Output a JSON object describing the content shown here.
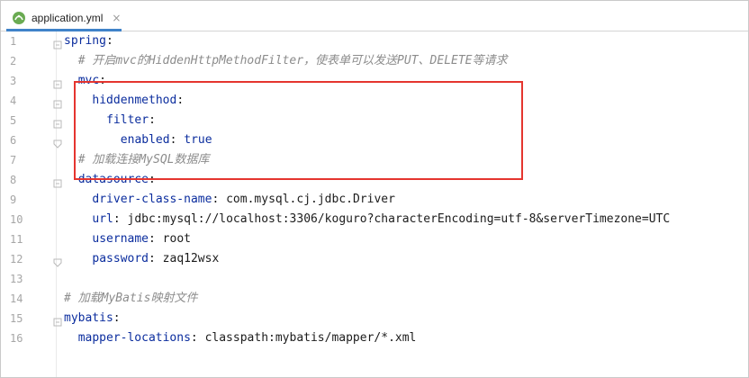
{
  "tab": {
    "filename": "application.yml",
    "close": "×",
    "icon": "yaml-file-icon"
  },
  "colors": {
    "key": "#0b2d9e",
    "comment": "#8c8c8c",
    "highlight_box": "#e5352f",
    "tab_underline": "#4083c9"
  },
  "lines": [
    {
      "num": "1",
      "parts": [
        {
          "t": "spring",
          "cls": "k"
        },
        {
          "t": ":",
          "cls": "v"
        }
      ],
      "indent": 0
    },
    {
      "num": "2",
      "parts": [
        {
          "t": "# 开启",
          "cls": "c"
        },
        {
          "t": "mvc",
          "cls": "c"
        },
        {
          "t": "的",
          "cls": "c"
        },
        {
          "t": "HiddenHttpMethodFilter",
          "cls": "c"
        },
        {
          "t": "，使表单可以发送",
          "cls": "c"
        },
        {
          "t": "PUT",
          "cls": "c"
        },
        {
          "t": "、",
          "cls": "c"
        },
        {
          "t": "DELETE",
          "cls": "c"
        },
        {
          "t": "等请求",
          "cls": "c"
        }
      ],
      "indent": 2
    },
    {
      "num": "3",
      "parts": [
        {
          "t": "mvc",
          "cls": "k"
        },
        {
          "t": ":",
          "cls": "v"
        }
      ],
      "indent": 2
    },
    {
      "num": "4",
      "parts": [
        {
          "t": "hiddenmethod",
          "cls": "k"
        },
        {
          "t": ":",
          "cls": "v"
        }
      ],
      "indent": 4
    },
    {
      "num": "5",
      "parts": [
        {
          "t": "filter",
          "cls": "k"
        },
        {
          "t": ":",
          "cls": "v"
        }
      ],
      "indent": 6
    },
    {
      "num": "6",
      "parts": [
        {
          "t": "enabled",
          "cls": "k"
        },
        {
          "t": ": ",
          "cls": "v"
        },
        {
          "t": "true",
          "cls": "k"
        }
      ],
      "indent": 8
    },
    {
      "num": "7",
      "parts": [
        {
          "t": "# 加载连接",
          "cls": "c"
        },
        {
          "t": "MySQL",
          "cls": "c"
        },
        {
          "t": "数据库",
          "cls": "c"
        }
      ],
      "indent": 2
    },
    {
      "num": "8",
      "parts": [
        {
          "t": "datasource",
          "cls": "k"
        },
        {
          "t": ":",
          "cls": "v"
        }
      ],
      "indent": 2
    },
    {
      "num": "9",
      "parts": [
        {
          "t": "driver-class-name",
          "cls": "k"
        },
        {
          "t": ": com.mysql.cj.jdbc.Driver",
          "cls": "v"
        }
      ],
      "indent": 4
    },
    {
      "num": "10",
      "parts": [
        {
          "t": "url",
          "cls": "k"
        },
        {
          "t": ": jdbc:mysql://localhost:3306/koguro?characterEncoding=utf-8&serverTimezone=UTC",
          "cls": "v"
        }
      ],
      "indent": 4
    },
    {
      "num": "11",
      "parts": [
        {
          "t": "username",
          "cls": "k"
        },
        {
          "t": ": root",
          "cls": "v"
        }
      ],
      "indent": 4
    },
    {
      "num": "12",
      "parts": [
        {
          "t": "password",
          "cls": "k"
        },
        {
          "t": ": zaq12wsx",
          "cls": "v"
        }
      ],
      "indent": 4
    },
    {
      "num": "13",
      "parts": [],
      "indent": 0
    },
    {
      "num": "14",
      "parts": [
        {
          "t": "# 加载",
          "cls": "c"
        },
        {
          "t": "MyBatis",
          "cls": "c"
        },
        {
          "t": "映射文件",
          "cls": "c"
        }
      ],
      "indent": 0
    },
    {
      "num": "15",
      "parts": [
        {
          "t": "mybatis",
          "cls": "k"
        },
        {
          "t": ":",
          "cls": "v"
        }
      ],
      "indent": 0
    },
    {
      "num": "16",
      "parts": [
        {
          "t": "mapper-locations",
          "cls": "k"
        },
        {
          "t": ": classpath:mybatis/mapper/*.xml",
          "cls": "v"
        }
      ],
      "indent": 2
    }
  ]
}
